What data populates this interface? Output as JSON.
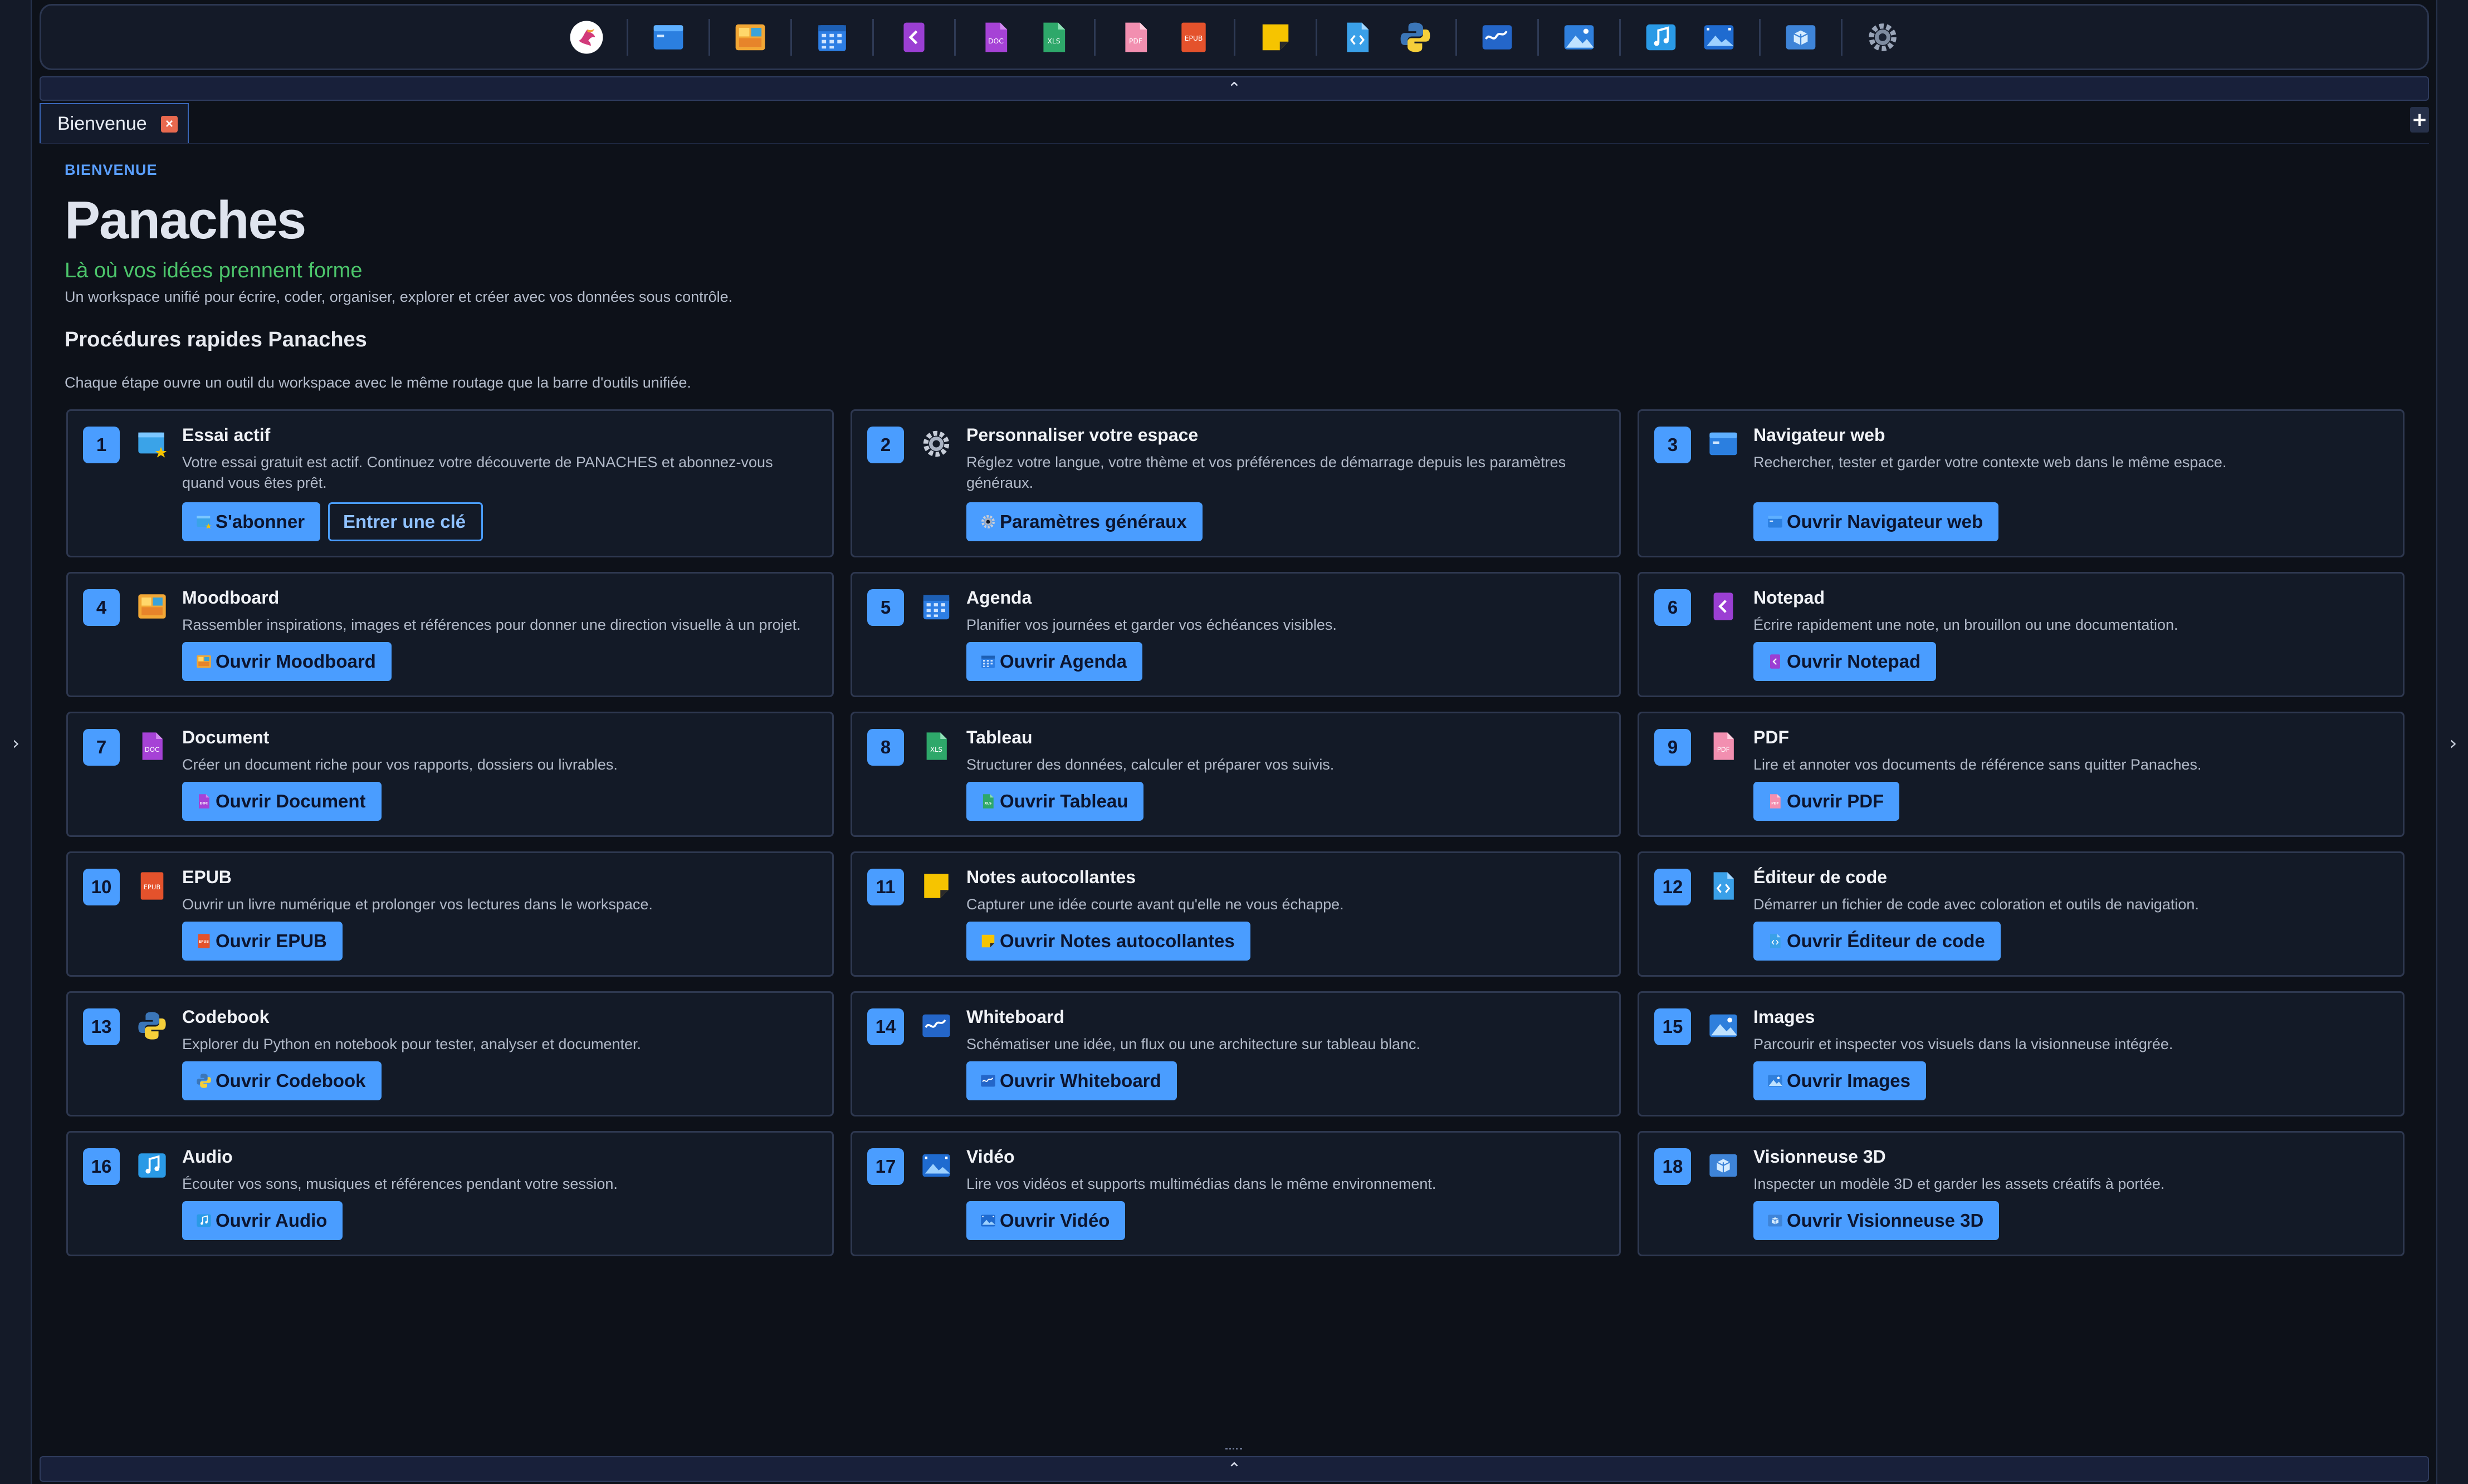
{
  "tab": {
    "label": "Bienvenue",
    "close": "×",
    "new": "+"
  },
  "rails": {
    "left_chevron": "›",
    "right_chevron": "›"
  },
  "collapse": {
    "top": "⌃",
    "bottom": "⌃"
  },
  "toolbar": {
    "icons": [
      "app-logo-icon",
      "web-browser-icon",
      "moodboard-icon",
      "agenda-icon",
      "notepad-icon",
      "document-icon",
      "spreadsheet-icon",
      "pdf-icon",
      "epub-icon",
      "sticky-note-icon",
      "code-editor-icon",
      "python-codebook-icon",
      "whiteboard-icon",
      "image-viewer-icon",
      "audio-icon",
      "video-icon",
      "viewer-3d-icon",
      "settings-icon"
    ]
  },
  "header": {
    "eyebrow": "BIENVENUE",
    "title": "Panaches",
    "tagline": "Là où vos idées prennent forme",
    "description": "Un workspace unifié pour écrire, coder, organiser, explorer et créer avec vos données sous contrôle."
  },
  "section": {
    "title": "Procédures rapides Panaches",
    "description": "Chaque étape ouvre un outil du workspace avec le même routage que la barre d'outils unifiée."
  },
  "cards": [
    {
      "num": "1",
      "title": "Essai actif",
      "desc": "Votre essai gratuit est actif. Continuez votre découverte de PANACHES et abonnez-vous quand vous êtes prêt.",
      "buttons": [
        "S'abonner",
        "Entrer une clé"
      ]
    },
    {
      "num": "2",
      "title": "Personnaliser votre espace",
      "desc": "Réglez votre langue, votre thème et vos préférences de démarrage depuis les paramètres généraux.",
      "buttons": [
        "Paramètres généraux"
      ]
    },
    {
      "num": "3",
      "title": "Navigateur web",
      "desc": "Rechercher, tester et garder votre contexte web dans le même espace.",
      "buttons": [
        "Ouvrir Navigateur web"
      ]
    },
    {
      "num": "4",
      "title": "Moodboard",
      "desc": "Rassembler inspirations, images et références pour donner une direction visuelle à un projet.",
      "buttons": [
        "Ouvrir Moodboard"
      ]
    },
    {
      "num": "5",
      "title": "Agenda",
      "desc": "Planifier vos journées et garder vos échéances visibles.",
      "buttons": [
        "Ouvrir Agenda"
      ]
    },
    {
      "num": "6",
      "title": "Notepad",
      "desc": "Écrire rapidement une note, un brouillon ou une documentation.",
      "buttons": [
        "Ouvrir Notepad"
      ]
    },
    {
      "num": "7",
      "title": "Document",
      "desc": "Créer un document riche pour vos rapports, dossiers ou livrables.",
      "buttons": [
        "Ouvrir Document"
      ]
    },
    {
      "num": "8",
      "title": "Tableau",
      "desc": "Structurer des données, calculer et préparer vos suivis.",
      "buttons": [
        "Ouvrir Tableau"
      ]
    },
    {
      "num": "9",
      "title": "PDF",
      "desc": "Lire et annoter vos documents de référence sans quitter Panaches.",
      "buttons": [
        "Ouvrir PDF"
      ]
    },
    {
      "num": "10",
      "title": "EPUB",
      "desc": "Ouvrir un livre numérique et prolonger vos lectures dans le workspace.",
      "buttons": [
        "Ouvrir EPUB"
      ]
    },
    {
      "num": "11",
      "title": "Notes autocollantes",
      "desc": "Capturer une idée courte avant qu'elle ne vous échappe.",
      "buttons": [
        "Ouvrir Notes autocollantes"
      ]
    },
    {
      "num": "12",
      "title": "Éditeur de code",
      "desc": "Démarrer un fichier de code avec coloration et outils de navigation.",
      "buttons": [
        "Ouvrir Éditeur de code"
      ]
    },
    {
      "num": "13",
      "title": "Codebook",
      "desc": "Explorer du Python en notebook pour tester, analyser et documenter.",
      "buttons": [
        "Ouvrir Codebook"
      ]
    },
    {
      "num": "14",
      "title": "Whiteboard",
      "desc": "Schématiser une idée, un flux ou une architecture sur tableau blanc.",
      "buttons": [
        "Ouvrir Whiteboard"
      ]
    },
    {
      "num": "15",
      "title": "Images",
      "desc": "Parcourir et inspecter vos visuels dans la visionneuse intégrée.",
      "buttons": [
        "Ouvrir Images"
      ]
    },
    {
      "num": "16",
      "title": "Audio",
      "desc": "Écouter vos sons, musiques et références pendant votre session.",
      "buttons": [
        "Ouvrir Audio"
      ]
    },
    {
      "num": "17",
      "title": "Vidéo",
      "desc": "Lire vos vidéos et supports multimédias dans le même environnement.",
      "buttons": [
        "Ouvrir Vidéo"
      ]
    },
    {
      "num": "18",
      "title": "Visionneuse 3D",
      "desc": "Inspecter un modèle 3D et garder les assets créatifs à portée.",
      "buttons": [
        "Ouvrir Visionneuse 3D"
      ]
    }
  ],
  "colors": {
    "accent": "#4a9dff",
    "background": "#0d1119",
    "card": "#131a27",
    "tagline": "#4cc56b"
  }
}
